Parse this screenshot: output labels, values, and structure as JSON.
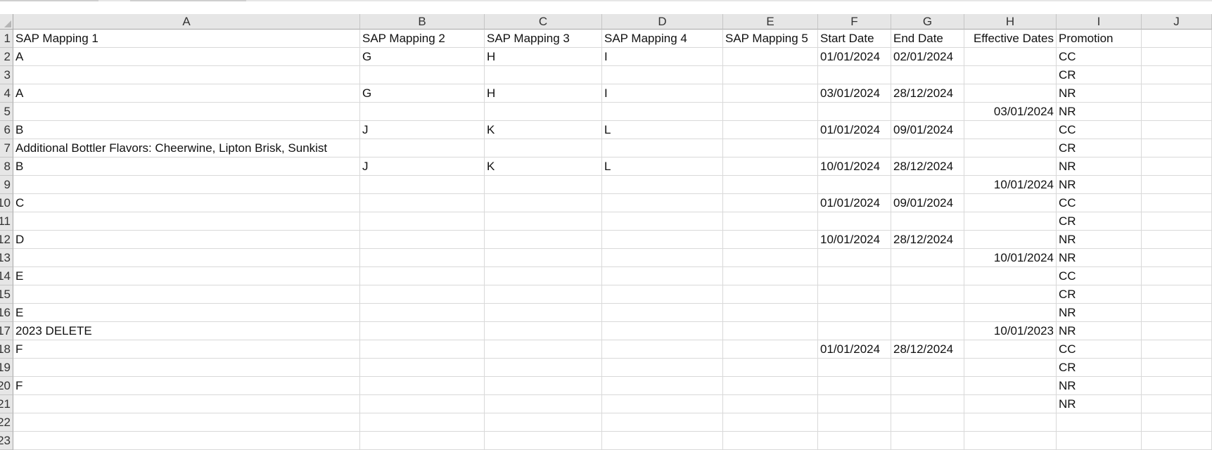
{
  "columns": [
    "A",
    "B",
    "C",
    "D",
    "E",
    "F",
    "G",
    "H",
    "I",
    "J"
  ],
  "row_numbers": [
    "1",
    "2",
    "3",
    "4",
    "5",
    "6",
    "7",
    "8",
    "9",
    "10",
    "11",
    "12",
    "13",
    "14",
    "15",
    "16",
    "17",
    "18",
    "19",
    "20",
    "21",
    "22",
    "23"
  ],
  "rows": [
    [
      "SAP Mapping 1",
      "SAP Mapping 2",
      "SAP Mapping 3",
      "SAP Mapping 4",
      "SAP Mapping 5",
      "Start Date",
      "End Date",
      "Effective Dates",
      "Promotion",
      ""
    ],
    [
      "A",
      "G",
      "H",
      "I",
      "",
      "01/01/2024",
      "02/01/2024",
      "",
      "CC",
      ""
    ],
    [
      "",
      "",
      "",
      "",
      "",
      "",
      "",
      "",
      "CR",
      ""
    ],
    [
      "A",
      "G",
      "H",
      "I",
      "",
      "03/01/2024",
      "28/12/2024",
      "",
      "NR",
      ""
    ],
    [
      "",
      "",
      "",
      "",
      "",
      "",
      "",
      "03/01/2024",
      "NR",
      ""
    ],
    [
      "B",
      "J",
      "K",
      "L",
      "",
      "01/01/2024",
      "09/01/2024",
      "",
      "CC",
      ""
    ],
    [
      "Additional Bottler Flavors: Cheerwine, Lipton Brisk, Sunkist",
      "",
      "",
      "",
      "",
      "",
      "",
      "",
      "CR",
      ""
    ],
    [
      "B",
      "J",
      "K",
      "L",
      "",
      "10/01/2024",
      "28/12/2024",
      "",
      "NR",
      ""
    ],
    [
      "",
      "",
      "",
      "",
      "",
      "",
      "",
      "10/01/2024",
      "NR",
      ""
    ],
    [
      "C",
      "",
      "",
      "",
      "",
      "01/01/2024",
      "09/01/2024",
      "",
      "CC",
      ""
    ],
    [
      "",
      "",
      "",
      "",
      "",
      "",
      "",
      "",
      "CR",
      ""
    ],
    [
      "D",
      "",
      "",
      "",
      "",
      "10/01/2024",
      "28/12/2024",
      "",
      "NR",
      ""
    ],
    [
      "",
      "",
      "",
      "",
      "",
      "",
      "",
      "10/01/2024",
      "NR",
      ""
    ],
    [
      "E",
      "",
      "",
      "",
      "",
      "",
      "",
      "",
      "CC",
      ""
    ],
    [
      "",
      "",
      "",
      "",
      "",
      "",
      "",
      "",
      "CR",
      ""
    ],
    [
      "E",
      "",
      "",
      "",
      "",
      "",
      "",
      "",
      "NR",
      ""
    ],
    [
      "2023 DELETE",
      "",
      "",
      "",
      "",
      "",
      "",
      "10/01/2023",
      "NR",
      ""
    ],
    [
      "F",
      "",
      "",
      "",
      "",
      "01/01/2024",
      "28/12/2024",
      "",
      "CC",
      ""
    ],
    [
      "",
      "",
      "",
      "",
      "",
      "",
      "",
      "",
      "CR",
      ""
    ],
    [
      "F",
      "",
      "",
      "",
      "",
      "",
      "",
      "",
      "NR",
      ""
    ],
    [
      "",
      "",
      "",
      "",
      "",
      "",
      "",
      "",
      "NR",
      ""
    ],
    [
      "",
      "",
      "",
      "",
      "",
      "",
      "",
      "",
      "",
      ""
    ],
    [
      "",
      "",
      "",
      "",
      "",
      "",
      "",
      "",
      "",
      ""
    ]
  ]
}
